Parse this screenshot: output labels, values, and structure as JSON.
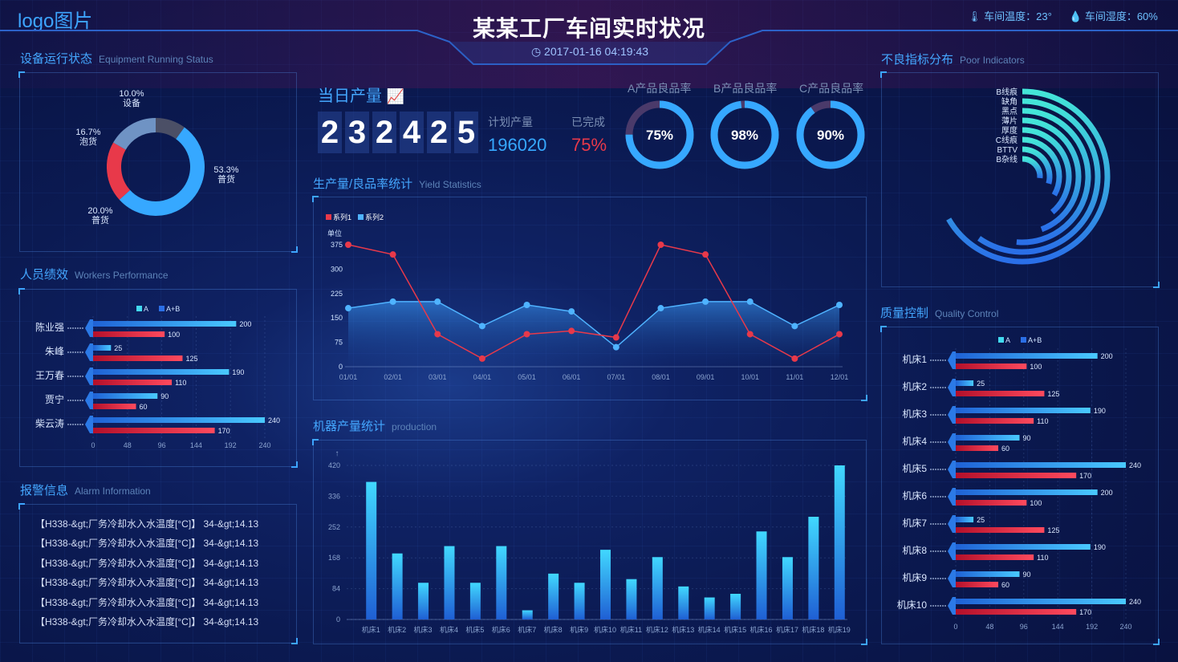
{
  "header": {
    "logo": "logo图片",
    "title": "某某工厂车间实时状况",
    "datetime": "2017-01-16 04:19:43",
    "temperature": "车间温度：23°",
    "humidity": "车间湿度：60%"
  },
  "equipment": {
    "title": "设备运行状态",
    "title_en": "Equipment Running Status",
    "segments": [
      {
        "pct": "10.0%",
        "label": "设备",
        "value": 10.0,
        "color": "#4b4f66"
      },
      {
        "pct": "53.3%",
        "label": "普货",
        "value": 53.3,
        "color": "#36a8ff"
      },
      {
        "pct": "20.0%",
        "label": "普货",
        "value": 20.0,
        "color": "#e8394a"
      },
      {
        "pct": "16.7%",
        "label": "泡货",
        "value": 16.7,
        "color": "#6f93c4"
      }
    ]
  },
  "workers": {
    "title": "人员绩效",
    "title_en": "Workers Performance",
    "legend": [
      "A",
      "A+B"
    ],
    "names": [
      "陈业强",
      "朱峰",
      "王万春",
      "贾宁",
      "柴云涛"
    ],
    "blue": [
      200,
      25,
      190,
      90,
      240
    ],
    "red": [
      100,
      125,
      110,
      60,
      170
    ],
    "ticks": [
      "0",
      "48",
      "96",
      "144",
      "192",
      "240"
    ]
  },
  "alarm": {
    "title": "报警信息",
    "title_en": "Alarm Information",
    "lines": [
      "【H338-&gt;厂务冷却水入水温度[°C]】 34-&gt;14.13",
      "【H338-&gt;厂务冷却水入水温度[°C]】 34-&gt;14.13",
      "【H338-&gt;厂务冷却水入水温度[°C]】 34-&gt;14.13",
      "【H338-&gt;厂务冷却水入水温度[°C]】 34-&gt;14.13",
      "【H338-&gt;厂务冷却水入水温度[°C]】 34-&gt;14.13",
      "【H338-&gt;厂务冷却水入水温度[°C]】 34-&gt;14.13"
    ]
  },
  "production": {
    "title": "当日产量",
    "digits": [
      "2",
      "3",
      "2",
      "4",
      "2",
      "5"
    ],
    "plan_label": "计划产量",
    "plan_value": "196020",
    "done_label": "已完成",
    "done_value": "75%",
    "rings": [
      {
        "label": "A产品良品率",
        "value": "75%",
        "fraction": 0.75
      },
      {
        "label": "B产品良品率",
        "value": "98%",
        "fraction": 0.98
      },
      {
        "label": "C产品良品率",
        "value": "90%",
        "fraction": 0.9
      }
    ]
  },
  "yield": {
    "title": "生产量/良品率统计",
    "title_en": "Yield Statistics"
  },
  "machine": {
    "title": "机器产量统计",
    "title_en": "production"
  },
  "poor": {
    "title": "不良指标分布",
    "title_en": "Poor Indicators",
    "labels": [
      "B线痕",
      "缺角",
      "黑点",
      "薄片",
      "厚度",
      "C线痕",
      "BTTV",
      "B杂线"
    ]
  },
  "quality": {
    "title": "质量控制",
    "title_en": "Quality Control",
    "legend": [
      "A",
      "A+B"
    ],
    "names": [
      "机床1",
      "机床2",
      "机床3",
      "机床4",
      "机床5",
      "机床6",
      "机床7",
      "机床8",
      "机床9",
      "机床10"
    ],
    "blue": [
      200,
      25,
      190,
      90,
      240,
      200,
      25,
      190,
      90,
      240
    ],
    "red": [
      100,
      125,
      110,
      60,
      170,
      100,
      125,
      110,
      60,
      170
    ],
    "ticks": [
      "0",
      "48",
      "96",
      "144",
      "192",
      "240"
    ]
  },
  "chart_data": [
    {
      "type": "area",
      "title": "",
      "ylabel": "单位",
      "x": [
        "01/01",
        "02/01",
        "03/01",
        "04/01",
        "05/01",
        "06/01",
        "07/01",
        "08/01",
        "09/01",
        "10/01",
        "11/01",
        "12/01"
      ],
      "yticks": [
        "0",
        "75",
        "150",
        "225",
        "300",
        "375"
      ],
      "ylim": [
        0,
        375
      ],
      "series": [
        {
          "name": "系列1",
          "color": "#e8394a",
          "values": [
            375,
            345,
            100,
            25,
            100,
            110,
            90,
            375,
            345,
            100,
            25,
            100
          ]
        },
        {
          "name": "系列2",
          "color": "#4fb3ff",
          "values": [
            180,
            200,
            200,
            125,
            190,
            170,
            60,
            180,
            200,
            200,
            125,
            190
          ]
        }
      ]
    },
    {
      "type": "bar",
      "title": "",
      "categories": [
        "机床1",
        "机床2",
        "机床3",
        "机床4",
        "机床5",
        "机床6",
        "机床7",
        "机床8",
        "机床9",
        "机床10",
        "机床11",
        "机床12",
        "机床13",
        "机床14",
        "机床15",
        "机床16",
        "机床17",
        "机床18",
        "机床19"
      ],
      "values": [
        375,
        180,
        100,
        200,
        100,
        200,
        25,
        125,
        100,
        190,
        110,
        170,
        90,
        60,
        70,
        240,
        170,
        280,
        420
      ],
      "yticks": [
        "0",
        "84",
        "168",
        "252",
        "336",
        "420"
      ],
      "ylim": [
        0,
        420
      ]
    }
  ]
}
